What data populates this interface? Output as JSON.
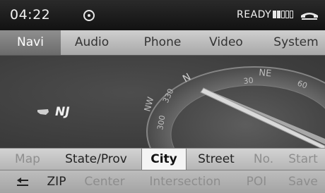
{
  "status": {
    "time": "04:22",
    "ready": "READY",
    "signal_level": "2 of 5 bars filled",
    "icons": [
      "radio-status-icon",
      "signal-strength-icon",
      "phone-icon"
    ]
  },
  "main_menu": {
    "items": [
      {
        "label": "Navi",
        "active": true
      },
      {
        "label": "Audio"
      },
      {
        "label": "Phone"
      },
      {
        "label": "Video"
      },
      {
        "label": "System"
      }
    ]
  },
  "map": {
    "state": "NJ",
    "compass_labels": {
      "ne": "NE",
      "nw": "NW",
      "n": "N",
      "deg_30": "30",
      "deg_60": "60",
      "deg_300": "300",
      "deg_330": "330"
    }
  },
  "fields": {
    "items": [
      {
        "label": "Map",
        "enabled": false
      },
      {
        "label": "State/Prov",
        "enabled": true
      },
      {
        "label": "City",
        "enabled": true,
        "selected": true
      },
      {
        "label": "Street",
        "enabled": true
      },
      {
        "label": "No.",
        "enabled": false
      },
      {
        "label": "Start",
        "enabled": false
      }
    ]
  },
  "bottom": {
    "items": [
      {
        "label": "ZIP",
        "enabled": true
      },
      {
        "label": "Center",
        "enabled": false
      },
      {
        "label": "Intersection",
        "enabled": false
      },
      {
        "label": "POI",
        "enabled": false
      },
      {
        "label": "Save",
        "enabled": false
      }
    ]
  },
  "colors": {
    "active_menu_text": "#ffffff",
    "disabled_text": "#8e8e8e",
    "selected_field_bg": "#f4f4f4"
  }
}
